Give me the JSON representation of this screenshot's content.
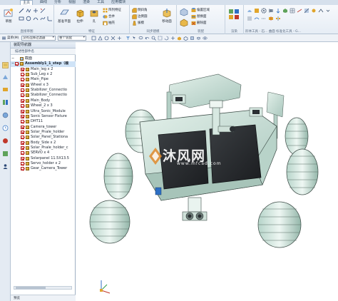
{
  "colors": {
    "ribbon_bg": "#eef2f7",
    "accent_blue": "#2d6fc4",
    "check_red": "#b42222",
    "part_gold": "#d9a62a",
    "model_body": "#c8dfd6",
    "solar_panel": "#2a2d30",
    "watermark_orange": "#e08a2c"
  },
  "ribbon": {
    "tabs": [
      {
        "label": "主页",
        "active": true
      },
      {
        "label": "曲线"
      },
      {
        "label": "分析"
      },
      {
        "label": "视图"
      },
      {
        "label": "渲染"
      },
      {
        "label": "工具"
      },
      {
        "label": "应用模块"
      }
    ],
    "groups": {
      "sketch": {
        "label": "直接草图",
        "sketch_label": "草图"
      },
      "feature": {
        "label": "特征",
        "datum_label": "基准平面",
        "extrude_label": "拉伸",
        "hole_label": "孔",
        "items": [
          "阵列特征",
          "合并",
          "抽壳"
        ],
        "more_label": "更多"
      },
      "sync": {
        "label": "同步建模",
        "items": [
          "倒斜角",
          "边倒圆",
          "拔模"
        ],
        "move_label": "移动面"
      },
      "assembly": {
        "label": "装配",
        "items": [
          "偏置区域",
          "替换面",
          "删除面"
        ]
      },
      "render": {
        "label": "渲染"
      },
      "right": {
        "labels": [
          "形体工具 - 石...",
          "曲面",
          "标准化工具 - G...",
          "齿轮建模",
          "弹簧",
          "加工",
          "建模"
        ]
      }
    }
  },
  "toolbar": {
    "menu_label": "菜单(M)",
    "filter_value": "没有选择过滤器",
    "assembly_scope": "整个装配"
  },
  "navigator": {
    "title": "装配导航器",
    "column_header": "描述性部件名",
    "items": [
      {
        "label": "截面",
        "level": 1,
        "check": false
      },
      {
        "label": "Assembly1_1_step（顺",
        "level": 1,
        "bold": true,
        "selected": true
      },
      {
        "label": "Main_leg x 2",
        "level": 2
      },
      {
        "label": "Sub_Leg x 2",
        "level": 2
      },
      {
        "label": "Main_Pipe",
        "level": 2
      },
      {
        "label": "Wheel x 3",
        "level": 2
      },
      {
        "label": "Stabilizer_Connectio",
        "level": 2
      },
      {
        "label": "Stabilizer_Connectio",
        "level": 2
      },
      {
        "label": "Main_Body",
        "level": 2
      },
      {
        "label": "Wheel_2 x 3",
        "level": 2
      },
      {
        "label": "Ultra_Sonic_Module",
        "level": 2
      },
      {
        "label": "Sonic Sensor Fixture",
        "level": 2
      },
      {
        "label": "DHT11",
        "level": 2
      },
      {
        "label": "Camera_tower",
        "level": 2
      },
      {
        "label": "Solar_Pnale_holder",
        "level": 2
      },
      {
        "label": "Solar_Panel_Stationa",
        "level": 2
      },
      {
        "label": "Body_Side x 2",
        "level": 2
      },
      {
        "label": "Solar_Pnale_holder_c",
        "level": 2
      },
      {
        "label": "SERVO x 4",
        "level": 2
      },
      {
        "label": "Solarpanel 11.5X13.5",
        "level": 2
      },
      {
        "label": "Servo_holder x 2",
        "level": 2
      },
      {
        "label": "Gear_Camera_Tower",
        "level": 2
      }
    ],
    "footer_label": "预览"
  },
  "viewport": {
    "watermark_text": "沐风网",
    "watermark_url": "www.mfcad.com"
  }
}
